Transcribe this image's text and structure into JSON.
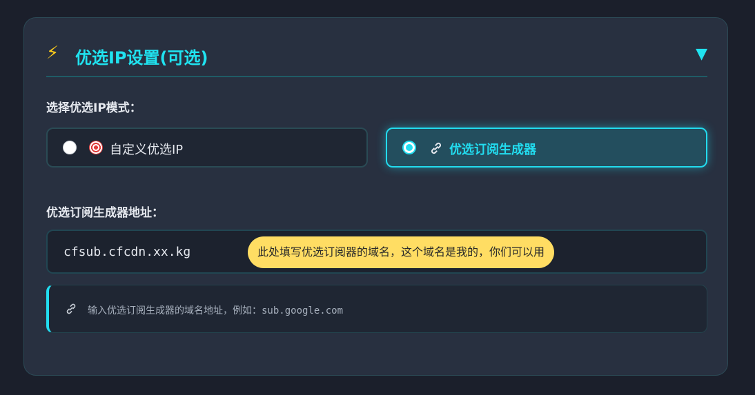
{
  "header": {
    "title": "优选IP设置(可选)",
    "title_icon": "lightning-icon",
    "toggle_icon": "triangle-down-icon"
  },
  "mode": {
    "label": "选择优选IP模式：",
    "options": [
      {
        "label": "自定义优选IP",
        "icon": "target-icon",
        "selected": false
      },
      {
        "label": "优选订阅生成器",
        "icon": "link-icon",
        "selected": true
      }
    ]
  },
  "generator": {
    "label": "优选订阅生成器地址：",
    "value": "cfsub.cfcdn.xx.kg",
    "tooltip": "此处填写优选订阅器的域名，这个域名是我的，你们可以用"
  },
  "hint": {
    "icon": "link-icon",
    "text_prefix": "输入优选订阅生成器的域名地址，例如：",
    "example": "sub.google.com"
  },
  "colors": {
    "accent": "#22dcef",
    "background": "#1b1f2b",
    "panel": "#283040",
    "tooltip": "#ffdd63"
  }
}
